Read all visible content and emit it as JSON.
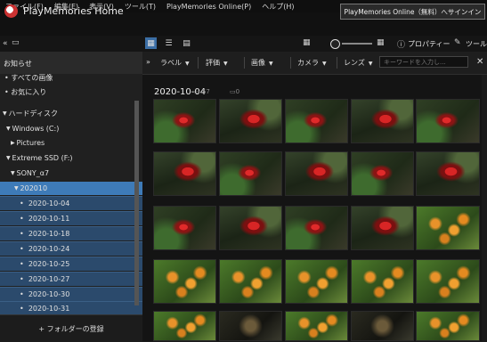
{
  "menu": [
    "ファイル(F)",
    "編集(E)",
    "表示(V)",
    "ツール(T)",
    "PlayMemories Online(P)",
    "ヘルプ(H)"
  ],
  "app": {
    "title": "PlayMemories Home",
    "online_button": "PlayMemories Online（無料）へサインイン"
  },
  "toolbar": {
    "properties_label": "プロパティー",
    "tools_label": "ツール"
  },
  "sidebar": {
    "notice": "お知らせ",
    "all_images": "すべての画像",
    "favorites": "お気に入り",
    "hard_disk": "ハードディスク",
    "windows_drive": "Windows (C:)",
    "pictures": "Pictures",
    "extreme_ssd": "Extreme SSD (F:)",
    "sony": "SONY_α7",
    "folder_202010": "202010",
    "dates": [
      "2020-10-04",
      "2020-10-11",
      "2020-10-18",
      "2020-10-24",
      "2020-10-25",
      "2020-10-27",
      "2020-10-30",
      "2020-10-31"
    ],
    "register_folder": "+ フォルダーの登録"
  },
  "filters": {
    "label": "ラベル",
    "rating": "評価",
    "image": "画像",
    "camera": "カメラ",
    "lens": "レンズ",
    "search_placeholder": "キーワードを入力し..."
  },
  "content": {
    "date": "2020-10-04",
    "photo_count": "57",
    "video_count": "0"
  },
  "thumb_rows": [
    [
      "lily",
      "lily2",
      "lily",
      "lily2",
      "lily"
    ],
    [
      "lily2",
      "lily",
      "lily2",
      "lily",
      "lily2"
    ],
    [
      "lily",
      "lily2",
      "lily",
      "lily2",
      "osm"
    ],
    [
      "osm",
      "osm",
      "osm",
      "osm",
      "osm"
    ],
    [
      "osm",
      "dark",
      "osm",
      "dark",
      "osm"
    ]
  ]
}
